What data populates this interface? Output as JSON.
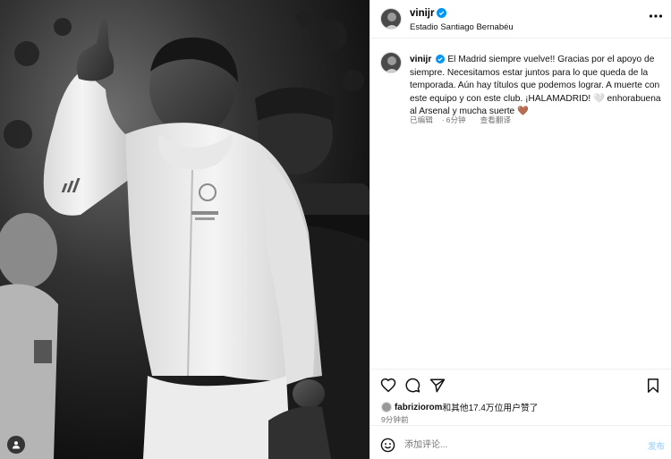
{
  "post": {
    "author": {
      "username": "vinijr",
      "verified": true,
      "location": "Estadio Santiago Bernabéu"
    },
    "media": {
      "description_icon": "person-tag-icon"
    },
    "caption": {
      "username": "vinijr",
      "text": "El Madrid siempre vuelve!! Gracias por el apoyo de siempre. Necesitamos estar juntos para lo que queda de la temporada. Aún hay títulos que podemos lograr. A muerte con este equipo y con este club. ¡HALAMADRID! 🤍 enhorabuena al Arsenal y mucha suerte 🤎",
      "edited": "已编辑",
      "separator": "·",
      "time": "6分钟",
      "translate": "查看翻译"
    },
    "actions": {
      "like_icon": "heart-icon",
      "comment_icon": "comment-icon",
      "share_icon": "share-icon",
      "save_icon": "bookmark-icon"
    },
    "likes": {
      "user": "fabriziorom",
      "rest": "和其他17.4万位用户赞了"
    },
    "time_ago": "9分钟前",
    "comment": {
      "placeholder": "添加评论...",
      "post_label": "发布"
    }
  },
  "colors": {
    "accent": "#0095f6",
    "post_disabled": "#b3dbff",
    "muted": "#737373",
    "border": "#efefef"
  }
}
